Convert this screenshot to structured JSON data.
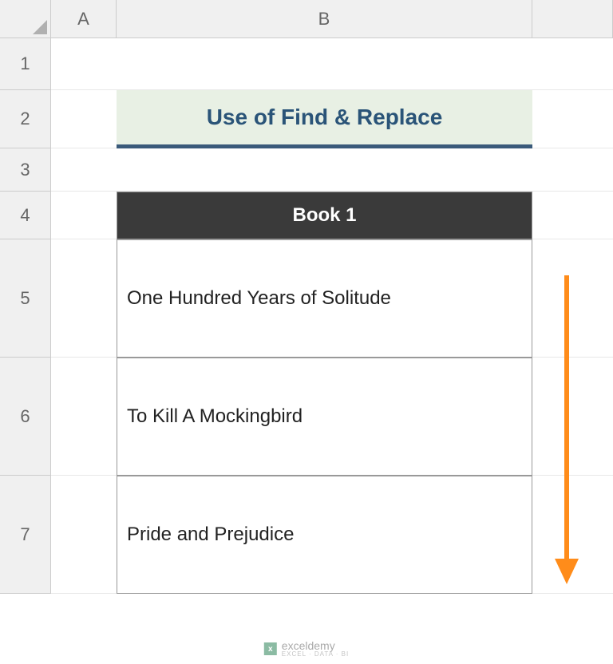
{
  "columns": [
    "A",
    "B"
  ],
  "rows": [
    "1",
    "2",
    "3",
    "4",
    "5",
    "6",
    "7"
  ],
  "title": "Use of Find & Replace",
  "table": {
    "header": "Book 1",
    "data": [
      "One Hundred Years of Solitude",
      "To Kill A Mockingbird",
      "Pride and Prejudice"
    ]
  },
  "watermark": {
    "brand": "exceldemy",
    "tagline": "EXCEL · DATA · BI"
  },
  "chart_data": {
    "type": "table",
    "title": "Use of Find & Replace",
    "columns": [
      "Book 1"
    ],
    "rows": [
      [
        "One Hundred Years of Solitude"
      ],
      [
        "To Kill A Mockingbird"
      ],
      [
        "Pride and Prejudice"
      ]
    ]
  }
}
